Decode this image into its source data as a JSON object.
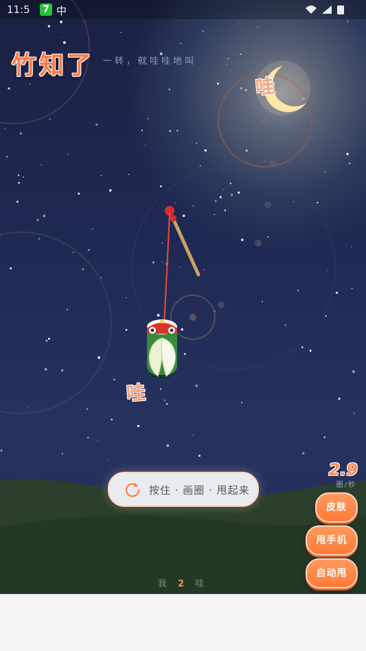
{
  "status_bar": {
    "time": "11:5",
    "badge": "7",
    "carrier": "中"
  },
  "header": {
    "title": "竹知了",
    "subtitle": "一转，就哇哇地叫"
  },
  "floating_words": {
    "top": "哇",
    "bottom": "哇"
  },
  "hint": {
    "label": "按住 · 画圈 · 甩起来"
  },
  "speed": {
    "value": "2.9",
    "unit": "圈/秒"
  },
  "buttons": {
    "skin": "皮肤",
    "shake": "甩手机",
    "auto": "自动甩"
  },
  "counter": {
    "prefix": "我",
    "count": "2",
    "suffix": "哇"
  },
  "colors": {
    "accent": "#ff7a45",
    "button": "#ff8a4a",
    "sky": "#1f2a55",
    "hill": "#243a26"
  }
}
